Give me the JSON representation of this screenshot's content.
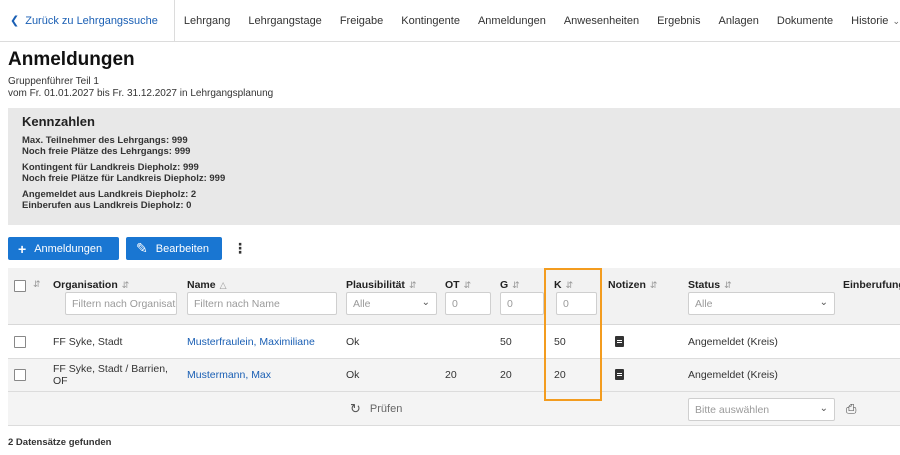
{
  "nav": {
    "back": "Zurück zu Lehrgangssuche",
    "tabs": [
      "Lehrgang",
      "Lehrgangstage",
      "Freigabe",
      "Kontingente",
      "Anmeldungen",
      "Anwesenheiten",
      "Ergebnis",
      "Anlagen",
      "Dokumente",
      "Historie"
    ]
  },
  "page": {
    "title": "Anmeldungen",
    "subtitle1": "Gruppenführer Teil 1",
    "subtitle2": "vom Fr. 01.01.2027 bis Fr. 31.12.2027 in Lehrgangsplanung"
  },
  "kennzahlen": {
    "heading": "Kennzahlen",
    "lines": [
      "Max. Teilnehmer des Lehrgangs: 999",
      "Noch freie Plätze des Lehrgangs: 999",
      "Kontingent für Landkreis Diepholz: 999",
      "Noch freie Plätze für Landkreis Diepholz: 999",
      "Angemeldet aus Landkreis Diepholz: 2",
      "Einberufen aus Landkreis Diepholz: 0"
    ]
  },
  "toolbar": {
    "add_label": "Anmeldungen",
    "edit_label": "Bearbeiten"
  },
  "table": {
    "headers": {
      "organisation": "Organisation",
      "name": "Name",
      "plausibilitaet": "Plausibilität",
      "ot": "OT",
      "g": "G",
      "k": "K",
      "notizen": "Notizen",
      "status": "Status",
      "einberufung": "Einberufung"
    },
    "filters": {
      "organisation": "Filtern nach Organisatic",
      "name": "Filtern nach Name",
      "plausibilitaet": "Alle",
      "ot": "0",
      "g": "0",
      "k": "0",
      "status": "Alle"
    },
    "rows": [
      {
        "organisation": "FF Syke, Stadt",
        "name": "Musterfraulein, Maximiliane",
        "plausibilitaet": "Ok",
        "ot": "",
        "g": "50",
        "k": "50",
        "status": "Angemeldet (Kreis)"
      },
      {
        "organisation": "FF Syke, Stadt / Barrien, OF",
        "name": "Mustermann, Max",
        "plausibilitaet": "Ok",
        "ot": "20",
        "g": "20",
        "k": "20",
        "status": "Angemeldet (Kreis)"
      }
    ],
    "footer": {
      "pruefen": "Prüfen",
      "select_placeholder": "Bitte auswählen"
    }
  },
  "result_count": "2 Datensätze gefunden"
}
